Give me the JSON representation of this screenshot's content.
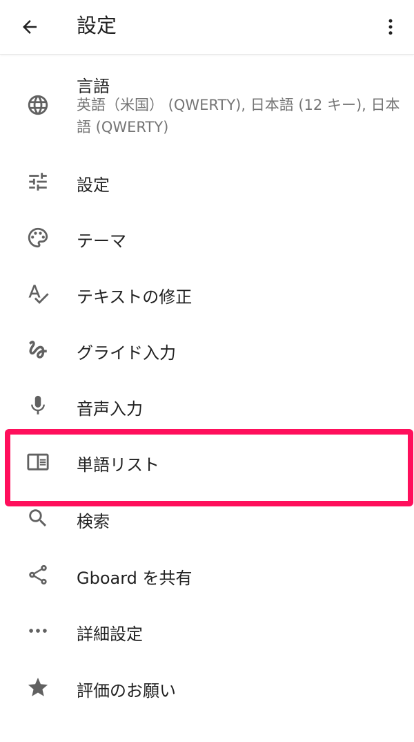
{
  "header": {
    "title": "設定",
    "back_icon": "arrow-back-icon",
    "more_icon": "more-vert-icon"
  },
  "items": [
    {
      "icon": "globe-icon",
      "label": "言語",
      "summary": "英語（米国） (QWERTY), 日本語 (12 キー), 日本語 (QWERTY)"
    },
    {
      "icon": "tune-icon",
      "label": "設定"
    },
    {
      "icon": "palette-icon",
      "label": "テーマ"
    },
    {
      "icon": "spellcheck-icon",
      "label": "テキストの修正"
    },
    {
      "icon": "gesture-icon",
      "label": "グライド入力"
    },
    {
      "icon": "mic-icon",
      "label": "音声入力"
    },
    {
      "icon": "book-icon",
      "label": "単語リスト"
    },
    {
      "icon": "search-icon",
      "label": "検索"
    },
    {
      "icon": "share-icon",
      "label": "Gboard を共有"
    },
    {
      "icon": "more-horiz-icon",
      "label": "詳細設定"
    },
    {
      "icon": "star-icon",
      "label": "評価のお願い"
    }
  ],
  "highlight": {
    "item": "単語リスト",
    "color": "#ff0f5c"
  },
  "colors": {
    "icon": "#616161",
    "text": "#212121",
    "secondary": "#757575",
    "background": "#ffffff"
  }
}
